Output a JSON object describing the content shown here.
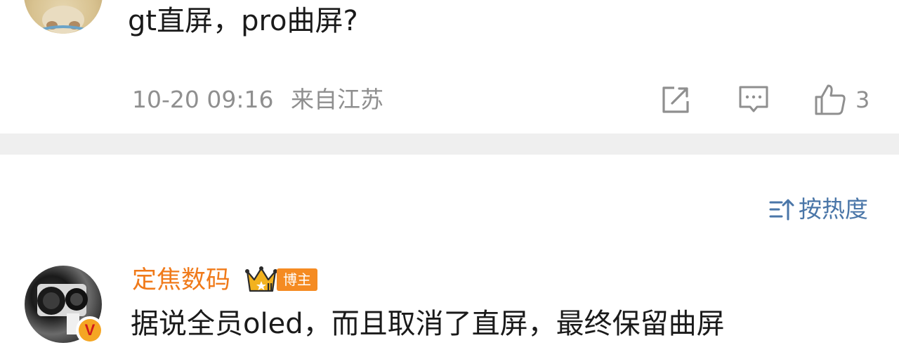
{
  "post": {
    "text": "gt直屏，pro曲屏?",
    "time": "10-20 09:16",
    "location": "来自江苏",
    "like_count": "3"
  },
  "sort": {
    "label": "按热度"
  },
  "comment": {
    "username": "定焦数码",
    "role_badge": "博主",
    "verified_mark": "V",
    "text": "据说全员oled，而且取消了直屏，最终保留曲屏"
  },
  "icons": {
    "share": "share-icon",
    "comment": "comment-icon",
    "like": "thumbs-up-icon",
    "sort": "sort-icon",
    "crown": "crown-icon"
  },
  "colors": {
    "username": "#f07a1a",
    "role_badge_bg": "#f58b22",
    "sort_link": "#4a76a8",
    "meta_gray": "#8f8f8f",
    "divider": "#efefef"
  }
}
